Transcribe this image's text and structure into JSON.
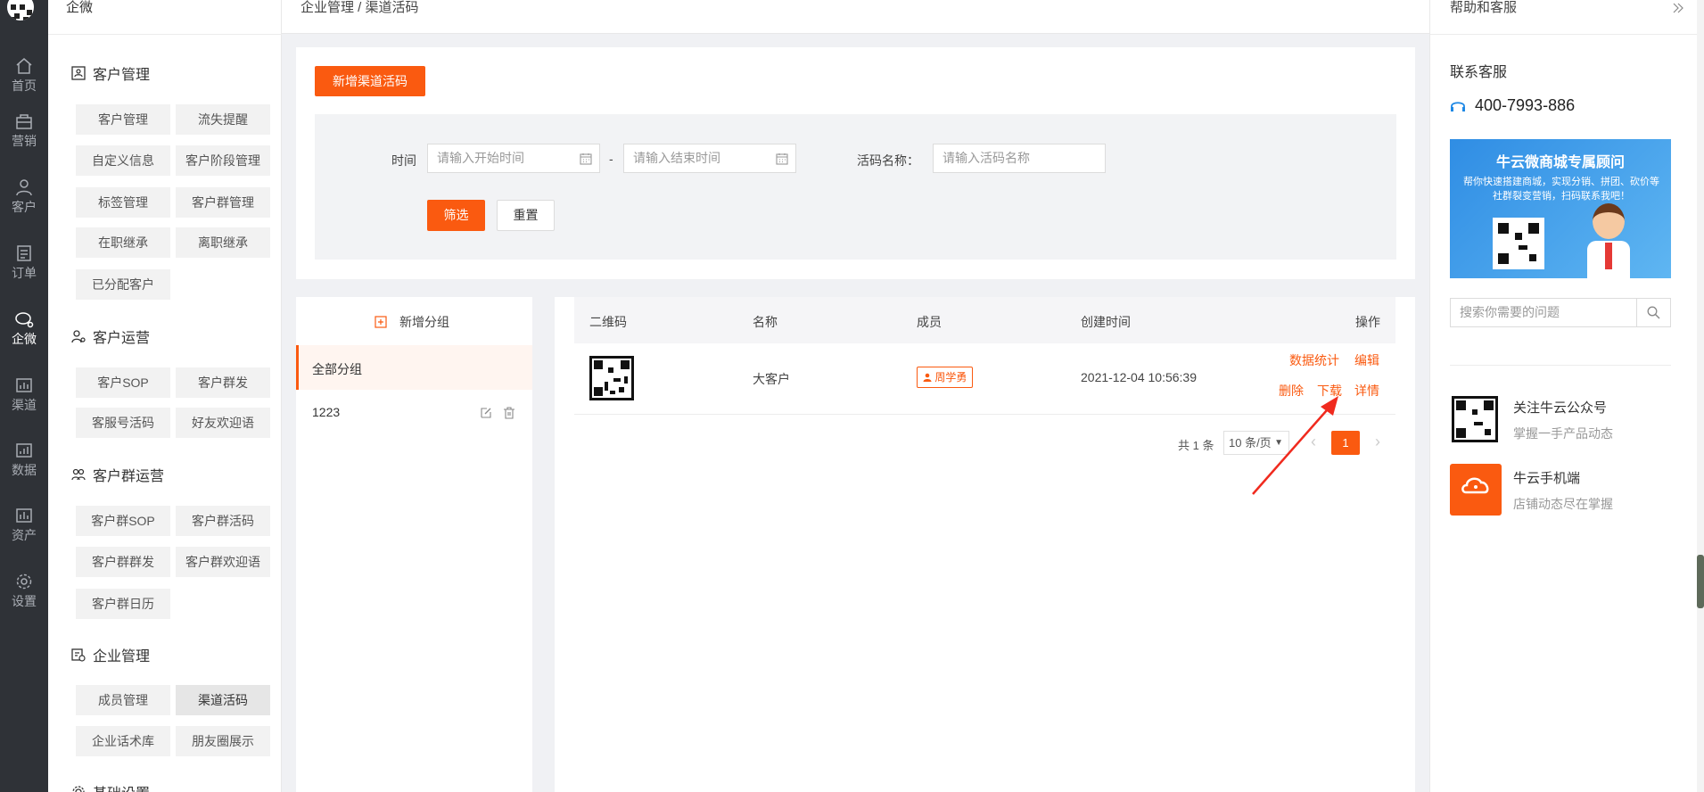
{
  "rail": {
    "items": [
      {
        "label": "首页",
        "icon": "home-icon"
      },
      {
        "label": "营销",
        "icon": "marketing-icon"
      },
      {
        "label": "客户",
        "icon": "customer-icon"
      },
      {
        "label": "订单",
        "icon": "order-icon"
      },
      {
        "label": "企微",
        "icon": "wecom-icon"
      },
      {
        "label": "渠道",
        "icon": "channel-icon"
      },
      {
        "label": "数据",
        "icon": "data-icon"
      },
      {
        "label": "资产",
        "icon": "asset-icon"
      },
      {
        "label": "设置",
        "icon": "settings-icon"
      }
    ]
  },
  "menu": {
    "title": "企微",
    "groups": [
      {
        "label": "客户管理",
        "items": [
          "客户管理",
          "流失提醒",
          "自定义信息",
          "客户阶段管理",
          "标签管理",
          "客户群管理",
          "在职继承",
          "离职继承",
          "已分配客户"
        ]
      },
      {
        "label": "客户运营",
        "items": [
          "客户SOP",
          "客户群发",
          "客服号活码",
          "好友欢迎语"
        ]
      },
      {
        "label": "客户群运营",
        "items": [
          "客户群SOP",
          "客户群活码",
          "客户群群发",
          "客户群欢迎语",
          "客户群日历"
        ]
      },
      {
        "label": "企业管理",
        "items": [
          "成员管理",
          "渠道活码",
          "企业话术库",
          "朋友圈展示"
        ]
      },
      {
        "label": "基础设置",
        "items": []
      }
    ]
  },
  "breadcrumb": "企业管理 / 渠道活码",
  "toolbar": {
    "add_label": "新增渠道活码"
  },
  "filter": {
    "time_label": "时间",
    "start_placeholder": "请输入开始时间",
    "dash": "-",
    "end_placeholder": "请输入结束时间",
    "name_label": "活码名称：",
    "name_placeholder": "请输入活码名称",
    "filter_label": "筛选",
    "reset_label": "重置"
  },
  "groups_panel": {
    "add_label": "新增分组",
    "items": [
      {
        "label": "全部分组",
        "active": true
      },
      {
        "label": "1223",
        "active": false
      }
    ]
  },
  "table": {
    "headers": [
      "二维码",
      "名称",
      "成员",
      "创建时间",
      "操作"
    ],
    "rows": [
      {
        "name": "大客户",
        "member": "周学勇",
        "created": "2021-12-04 10:56:39",
        "ops": [
          "数据统计",
          "编辑",
          "删除",
          "下载",
          "详情"
        ]
      }
    ]
  },
  "pagination": {
    "total": "共 1 条",
    "page_size": "10 条/页",
    "current": "1"
  },
  "help": {
    "title": "帮助和客服",
    "contact_title": "联系客服",
    "phone": "400-7993-886",
    "banner_title": "牛云微商城专属顾问",
    "banner_text": "帮你快速搭建商城，实现分销、拼团、砍价等社群裂变营销，扫码联系我吧！",
    "search_placeholder": "搜索你需要的问题",
    "promos": [
      {
        "title": "关注牛云公众号",
        "subtitle": "掌握一手产品动态"
      },
      {
        "title": "牛云手机端",
        "subtitle": "店铺动态尽在掌握"
      }
    ]
  },
  "colors": {
    "accent": "#fa5a10",
    "rail": "#2f3237"
  }
}
